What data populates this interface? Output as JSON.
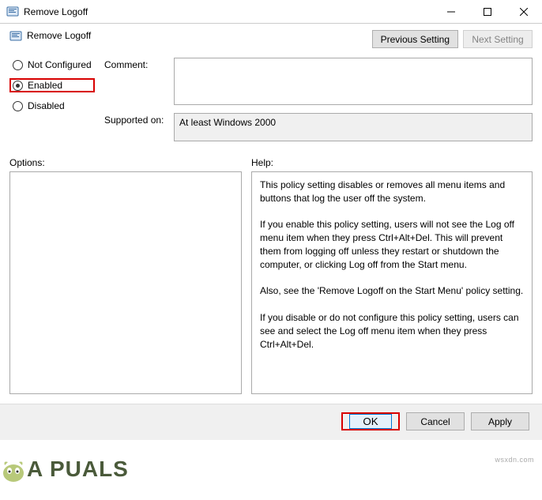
{
  "window": {
    "title": "Remove Logoff"
  },
  "header": {
    "policy_title": "Remove Logoff",
    "previous_setting": "Previous Setting",
    "next_setting": "Next Setting"
  },
  "radio": {
    "not_configured": "Not Configured",
    "enabled": "Enabled",
    "disabled": "Disabled",
    "selected": "enabled"
  },
  "fields": {
    "comment_label": "Comment:",
    "comment_value": "",
    "supported_label": "Supported on:",
    "supported_value": "At least Windows 2000"
  },
  "columns": {
    "options_label": "Options:",
    "help_label": "Help:"
  },
  "help_text": "This policy setting disables or removes all menu items and buttons that log the user off the system.\n\nIf you enable this policy setting, users will not see the Log off menu item when they press Ctrl+Alt+Del. This will prevent them from logging off unless they restart or shutdown the computer, or clicking Log off from the Start menu.\n\nAlso, see the 'Remove Logoff on the Start Menu' policy setting.\n\nIf you disable or do not configure this policy setting, users can see and select the Log off menu item when they press Ctrl+Alt+Del.",
  "buttons": {
    "ok": "OK",
    "cancel": "Cancel",
    "apply": "Apply"
  },
  "watermark": "wsxdn.com",
  "brand": "A  PUALS"
}
